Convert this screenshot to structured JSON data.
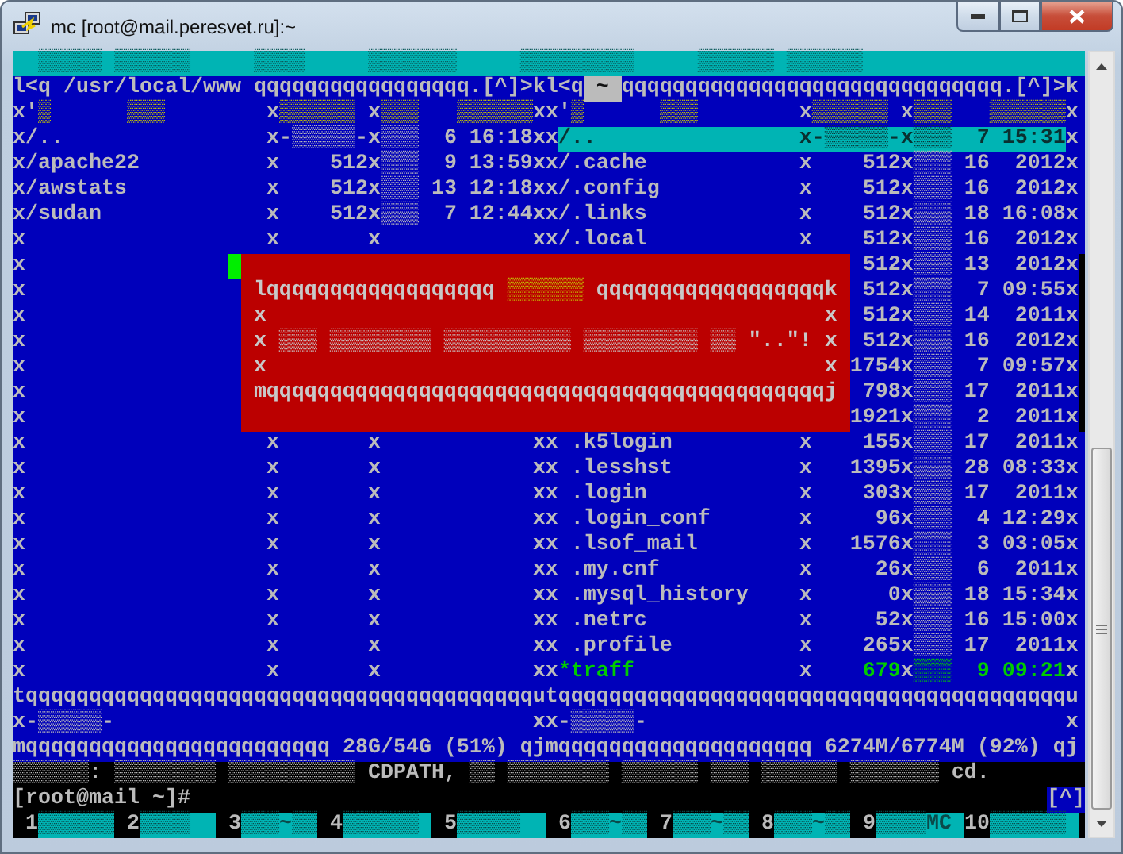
{
  "window": {
    "title": "mc [root@mail.peresvet.ru]:~"
  },
  "terminal": {
    "top_lines": [
      {
        "kind": "menu",
        "segments": [
          {
            "kind": "menu",
            "text": "▒▒▒▒▒ ▒▒▒▒▒▒"
          },
          {
            "kind": "menu",
            "text": "▒▒▒▒"
          },
          {
            "kind": "menu",
            "text": "▒▒▒▒▒▒▒"
          },
          {
            "kind": "menu",
            "text": "▒▒▒▒▒▒▒▒▒"
          },
          {
            "kind": "menu",
            "text": "▒▒▒▒▒▒ ▒▒▒▒▒▒"
          }
        ]
      },
      {
        "kind": "panel",
        "segments": [
          {
            "kind": "text",
            "text": "l<q /usr/local/www qqqqqqqqqqqqqqqqq.[^]>kl<q"
          },
          {
            "kind": "current",
            "text": " ~ "
          },
          {
            "kind": "text",
            "text": "qqqqqqqqqqqqqqqqqqqqqqqqqqqqqq.[^]>k"
          }
        ]
      },
      {
        "kind": "panel",
        "segments": [
          {
            "kind": "text",
            "text": "x'"
          },
          {
            "kind": "header",
            "text": "▒      ▒▒▒"
          },
          {
            "kind": "text",
            "text": "        x"
          },
          {
            "kind": "header",
            "text": "▒▒▒▒▒▒"
          },
          {
            "kind": "text",
            "text": " x"
          },
          {
            "kind": "header",
            "text": "▒▒▒   ▒▒▒▒▒▒"
          },
          {
            "kind": "text",
            "text": "xx'"
          },
          {
            "kind": "header",
            "text": "▒      ▒▒▒"
          },
          {
            "kind": "text",
            "text": "        x"
          },
          {
            "kind": "header",
            "text": "▒▒▒▒▒▒"
          },
          {
            "kind": "text",
            "text": " x"
          },
          {
            "kind": "header",
            "text": "▒▒▒   ▒▒▒▒▒▒"
          },
          {
            "kind": "text",
            "text": "x"
          }
        ]
      },
      {
        "kind": "panel",
        "segments": [
          {
            "kind": "text",
            "text": "x/..                x-▒▒▒▒▒-x▒▒▒  6 16:18xx"
          },
          {
            "kind": "selected",
            "text": "/..                x-▒▒▒▒▒-x▒▒▒  7 15:31"
          },
          {
            "kind": "text",
            "text": "x"
          }
        ]
      },
      {
        "kind": "panel",
        "segments": [
          {
            "kind": "text",
            "text": "x/apache22          x    512x▒▒▒  9 13:59xx/.cache            x    512x▒▒▒ 16  2012x"
          }
        ]
      },
      {
        "kind": "panel",
        "segments": [
          {
            "kind": "text",
            "text": "x/awstats           x    512x▒▒▒ 13 12:18xx/.config           x    512x▒▒▒ 16  2012x"
          }
        ]
      },
      {
        "kind": "panel",
        "segments": [
          {
            "kind": "text",
            "text": "x/sudan             x    512x▒▒▒  7 12:44xx/.links            x    512x▒▒▒ 18 16:08x"
          }
        ]
      },
      {
        "kind": "panel",
        "segments": [
          {
            "kind": "text",
            "text": "x                   x       x            xx/.local            x    512x▒▒▒ 16  2012x"
          }
        ]
      }
    ],
    "middle": {
      "left_lines": [
        {
          "kind": "panel",
          "segments": [
            {
              "kind": "text",
              "text": "x"
            },
            {
              "kind": "cursor"
            }
          ]
        },
        {
          "kind": "panel",
          "segments": [
            {
              "kind": "text",
              "text": "x"
            }
          ]
        },
        {
          "kind": "panel",
          "segments": [
            {
              "kind": "text",
              "text": "x"
            }
          ]
        },
        {
          "kind": "panel",
          "segments": [
            {
              "kind": "text",
              "text": "x"
            }
          ]
        },
        {
          "kind": "panel",
          "segments": [
            {
              "kind": "text",
              "text": "x"
            }
          ]
        },
        {
          "kind": "panel",
          "segments": [
            {
              "kind": "text",
              "text": "x"
            }
          ]
        },
        {
          "kind": "panel",
          "segments": [
            {
              "kind": "text",
              "text": "x"
            }
          ]
        }
      ],
      "dialog": {
        "lines": [
          {
            "segments": [
              {
                "kind": "dialog",
                "text": "lqqqqqqqqqqqqqqqqqq "
              },
              {
                "kind": "dialog-title",
                "text": "▒▒▒▒▒▒"
              },
              {
                "kind": "dialog",
                "text": " qqqqqqqqqqqqqqqqqqk"
              }
            ]
          },
          {
            "segments": [
              {
                "kind": "dialog",
                "text": "x                                            x"
              }
            ]
          },
          {
            "segments": [
              {
                "kind": "dialog",
                "text": "x ▒▒▒ ▒▒▒▒▒▒▒▒ ▒▒▒▒▒▒▒▒▒▒ ▒▒▒▒▒▒▒▒▒ ▒▒ \"..\"! x"
              }
            ]
          },
          {
            "segments": [
              {
                "kind": "dialog",
                "text": "x                                            x"
              }
            ]
          },
          {
            "segments": [
              {
                "kind": "dialog",
                "text": "mqqqqqqqqqqqqqqqqqqqqqqqqqqqqqqqqqqqqqqqqqqqqj"
              }
            ]
          }
        ]
      },
      "right_lines": [
        {
          "kind": "panel",
          "segments": [
            {
              "kind": "text",
              "text": " 512x▒▒▒ 13  2012x"
            }
          ]
        },
        {
          "kind": "panel",
          "segments": [
            {
              "kind": "text",
              "text": " 512x▒▒▒  7 09:55x"
            }
          ]
        },
        {
          "kind": "panel",
          "segments": [
            {
              "kind": "text",
              "text": " 512x▒▒▒ 14  2011x"
            }
          ]
        },
        {
          "kind": "panel",
          "segments": [
            {
              "kind": "text",
              "text": " 512x▒▒▒ 16  2012x"
            }
          ]
        },
        {
          "kind": "panel",
          "segments": [
            {
              "kind": "text",
              "text": "1754x▒▒▒  7 09:57x"
            }
          ]
        },
        {
          "kind": "panel",
          "segments": [
            {
              "kind": "text",
              "text": " 798x▒▒▒ 17  2011x"
            }
          ]
        },
        {
          "kind": "panel",
          "segments": [
            {
              "kind": "text",
              "text": "1921x▒▒▒  2  2011x"
            }
          ]
        }
      ]
    },
    "bottom_lines": [
      {
        "kind": "panel",
        "segments": [
          {
            "kind": "text",
            "text": "x                   x       x            xx .k5login          x    155x▒▒▒ 17  2011x"
          }
        ]
      },
      {
        "kind": "panel",
        "segments": [
          {
            "kind": "text",
            "text": "x                   x       x            xx .lesshst          x   1395x▒▒▒ 28 08:33x"
          }
        ]
      },
      {
        "kind": "panel",
        "segments": [
          {
            "kind": "text",
            "text": "x                   x       x            xx .login            x    303x▒▒▒ 17  2011x"
          }
        ]
      },
      {
        "kind": "panel",
        "segments": [
          {
            "kind": "text",
            "text": "x                   x       x            xx .login_conf       x     96x▒▒▒  4 12:29x"
          }
        ]
      },
      {
        "kind": "panel",
        "segments": [
          {
            "kind": "text",
            "text": "x                   x       x            xx .lsof_mail        x   1576x▒▒▒  3 03:05x"
          }
        ]
      },
      {
        "kind": "panel",
        "segments": [
          {
            "kind": "text",
            "text": "x                   x       x            xx .my.cnf           x     26x▒▒▒  6  2011x"
          }
        ]
      },
      {
        "kind": "panel",
        "segments": [
          {
            "kind": "text",
            "text": "x                   x       x            xx .mysql_history    x      0x▒▒▒ 18 15:34x"
          }
        ]
      },
      {
        "kind": "panel",
        "segments": [
          {
            "kind": "text",
            "text": "x                   x       x            xx .netrc            x     52x▒▒▒ 16 15:00x"
          }
        ]
      },
      {
        "kind": "panel",
        "segments": [
          {
            "kind": "text",
            "text": "x                   x       x            xx .profile          x    265x▒▒▒ 17  2011x"
          }
        ]
      },
      {
        "kind": "panel",
        "segments": [
          {
            "kind": "text",
            "text": "x                   x       x            xx"
          },
          {
            "kind": "exec",
            "text": "*traff             "
          },
          {
            "kind": "text",
            "text": "x"
          },
          {
            "kind": "exec",
            "text": "    679"
          },
          {
            "kind": "text",
            "text": "x"
          },
          {
            "kind": "exec",
            "text": "▒▒▒  9 09:21"
          },
          {
            "kind": "text",
            "text": "x"
          }
        ]
      },
      {
        "kind": "panel",
        "segments": [
          {
            "kind": "text",
            "text": "tqqqqqqqqqqqqqqqqqqqqqqqqqqqqqqqqqqqqqqqqutqqqqqqqqqqqqqqqqqqqqqqqqqqqqqqqqqqqqqqqqu"
          }
        ]
      },
      {
        "kind": "panel",
        "segments": [
          {
            "kind": "text",
            "text": "x-▒▒▒▒▒-                                 xx-▒▒▒▒▒-                                 x"
          }
        ]
      },
      {
        "kind": "panel",
        "segments": [
          {
            "kind": "text",
            "text": "mqqqqqqqqqqqqqqqqqqqqqqqq 28G/54G (51%) qjmqqqqqqqqqqqqqqqqqqqq 6274M/6774M (92%) qj"
          }
        ]
      },
      {
        "kind": "shell",
        "segments": [
          {
            "kind": "text",
            "text": "▒▒▒▒▒▒: ▒▒▒▒▒▒▒▒ ▒▒▒▒▒▒▒▒▒▒ CDPATH, ▒▒ ▒▒▒▒▒▒▒▒ ▒▒▒▒▒▒ ▒▒▒ ▒▒▒▒▒▒ ▒▒▒▒▒▒▒ cd."
          }
        ]
      },
      {
        "kind": "shell",
        "segments": [
          {
            "kind": "text",
            "text": "[root@mail ~]#"
          },
          {
            "kind": "hint",
            "text": "[^]"
          }
        ]
      },
      {
        "kind": "keys",
        "segments": [
          {
            "kind": "key-number",
            "text": " 1"
          },
          {
            "kind": "key-label",
            "text": "▒▒▒▒▒▒"
          },
          {
            "kind": "key-number",
            "text": " 2"
          },
          {
            "kind": "key-label",
            "text": "▒▒▒▒  "
          },
          {
            "kind": "key-number",
            "text": " 3"
          },
          {
            "kind": "key-label",
            "text": "▒▒▒~▒▒"
          },
          {
            "kind": "key-number",
            "text": " 4"
          },
          {
            "kind": "key-label",
            "text": "▒▒▒▒▒▒ "
          },
          {
            "kind": "key-number",
            "text": " 5"
          },
          {
            "kind": "key-label",
            "text": "▒▒▒▒▒  "
          },
          {
            "kind": "key-number",
            "text": " 6"
          },
          {
            "kind": "key-label",
            "text": "▒▒▒~▒▒"
          },
          {
            "kind": "key-number",
            "text": " 7"
          },
          {
            "kind": "key-label",
            "text": "▒▒▒~▒▒"
          },
          {
            "kind": "key-number",
            "text": " 8"
          },
          {
            "kind": "key-label",
            "text": "▒▒▒~▒▒"
          },
          {
            "kind": "key-number",
            "text": " 9"
          },
          {
            "kind": "key-label",
            "text": "▒▒▒▒MC "
          },
          {
            "kind": "key-number",
            "text": "10"
          },
          {
            "kind": "key-label",
            "text": "▒▒▒▒▒▒ "
          }
        ]
      }
    ]
  }
}
